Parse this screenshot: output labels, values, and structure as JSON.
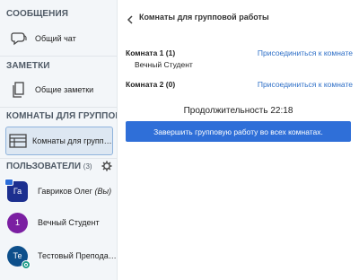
{
  "sidebar": {
    "messages": {
      "title": "СООБЩЕНИЯ",
      "items": [
        {
          "label": "Общий чат",
          "icon": "chat-icon"
        }
      ]
    },
    "notes": {
      "title": "ЗАМЕТКИ",
      "items": [
        {
          "label": "Общие заметки",
          "icon": "notes-icon"
        }
      ]
    },
    "breakout": {
      "title": "КОМНАТЫ ДЛЯ ГРУППОВОЙ",
      "items": [
        {
          "label": "Комнаты для групповой работы",
          "icon": "rooms-icon"
        }
      ]
    },
    "users": {
      "title": "ПОЛЬЗОВАТЕЛИ",
      "count": "(3)",
      "list": [
        {
          "initials": "Га",
          "name": "Гавриков Олег",
          "suffix": "(Вы)",
          "color": "#1c2f8f"
        },
        {
          "initials": "1",
          "name": "Вечный Студент",
          "suffix": "",
          "color": "#7b1fa2"
        },
        {
          "initials": "Те",
          "name": "Тестовый Преподаватель",
          "suffix": "",
          "color": "#0d4f8b"
        }
      ]
    }
  },
  "main": {
    "title": "Комнаты для групповой работы",
    "rooms": [
      {
        "name": "Комната 1 (1)",
        "join": "Присоединиться к комнате",
        "members": [
          "Вечный Студент"
        ]
      },
      {
        "name": "Комната 2 (0)",
        "join": "Присоединиться к комнате",
        "members": []
      }
    ],
    "duration": "Продолжительность 22:18",
    "end_button": "Завершить групповую работу во всех комнатах."
  },
  "colors": {
    "accent": "#2f6fd8",
    "link": "#2e6fc7",
    "sidebar_bg": "#f3f6f9"
  }
}
